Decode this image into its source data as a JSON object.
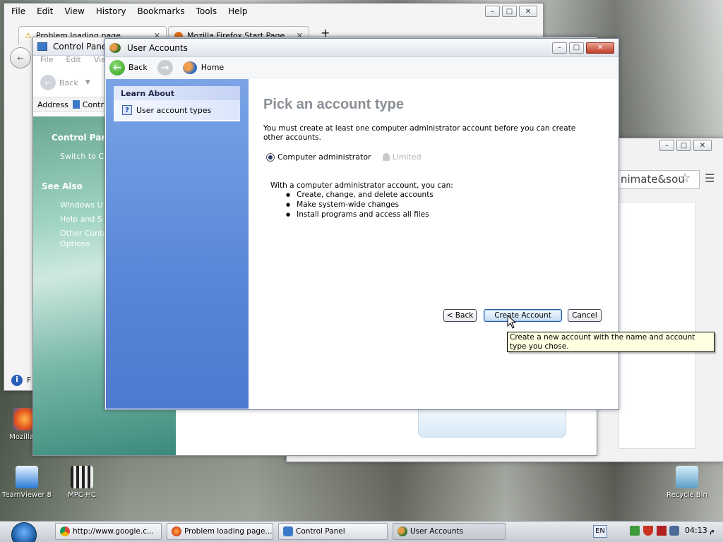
{
  "desktop": {
    "icons": [
      {
        "label": "Mozilla F"
      },
      {
        "label": "TeamViewer 8"
      },
      {
        "label": "MPC-HC"
      },
      {
        "label": "Recycle Bin"
      }
    ]
  },
  "firefox": {
    "menu": [
      "File",
      "Edit",
      "View",
      "History",
      "Bookmarks",
      "Tools",
      "Help"
    ],
    "tabs": [
      {
        "label": "Problem loading page"
      },
      {
        "label": "Mozilla Firefox Start Page"
      }
    ],
    "new_tab": "+"
  },
  "control_panel": {
    "title": "Control Panel",
    "menu": [
      "File",
      "Edit",
      "View"
    ],
    "back_label": "Back",
    "address_label": "Address",
    "address_value": "Contr",
    "panel_title": "Control Panel",
    "switch_label": "Switch to Cl",
    "see_also": "See Also",
    "links": [
      "Windows U",
      "Help and S",
      "Other Contr",
      "Options"
    ]
  },
  "chrome": {
    "url_fragment": "nimate&sou"
  },
  "user_accounts": {
    "title": "User Accounts",
    "nav": {
      "back": "Back",
      "home": "Home"
    },
    "learn_about": {
      "heading": "Learn About",
      "item": "User account types"
    },
    "heading": "Pick an account type",
    "instruction": "You must create at least one computer administrator account before you can create other accounts.",
    "options": [
      {
        "label": "Computer administrator",
        "selected": true
      },
      {
        "label": "Limited",
        "enabled": false
      }
    ],
    "capabilities_intro": "With a computer administrator account, you can:",
    "capabilities": [
      "Create, change, and delete accounts",
      "Make system-wide changes",
      "Install programs and access all files"
    ],
    "buttons": {
      "back": "< Back",
      "create": "Create Account",
      "cancel": "Cancel"
    },
    "tooltip": "Create a new account with the name and account type you chose."
  },
  "taskbar": {
    "tasks": [
      {
        "label": "http://www.google.c..."
      },
      {
        "label": "Problem loading page..."
      },
      {
        "label": "Control Panel"
      },
      {
        "label": "User Accounts"
      }
    ],
    "language": "EN",
    "clock": "04:13 م"
  },
  "colors": {
    "xp_blue_pane": "#5a86d8",
    "title_gray": "#8a8f96",
    "tooltip_bg": "#ffffe1"
  }
}
